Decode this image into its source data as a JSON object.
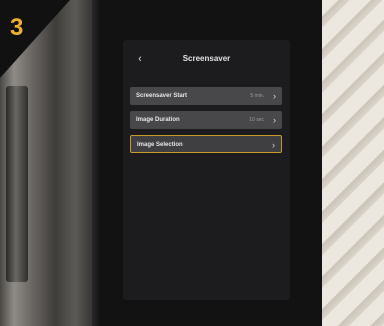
{
  "overlay": {
    "step_number": "3"
  },
  "screen": {
    "title": "Screensaver",
    "back_icon": "chevron-left-icon",
    "menu": [
      {
        "label": "Screensaver Start",
        "value": "5 min.",
        "icon": "chevron-right-icon",
        "selected": false
      },
      {
        "label": "Image Duration",
        "value": "10 sec",
        "icon": "chevron-right-icon",
        "selected": false
      },
      {
        "label": "Image Selection",
        "value": "",
        "icon": "chevron-right-icon",
        "selected": true
      }
    ]
  },
  "colors": {
    "accent_border": "#c89a2a",
    "step_number": "#f0b12a",
    "menu_item_bg": "#48484b",
    "screen_bg": "#1c1c1e"
  }
}
